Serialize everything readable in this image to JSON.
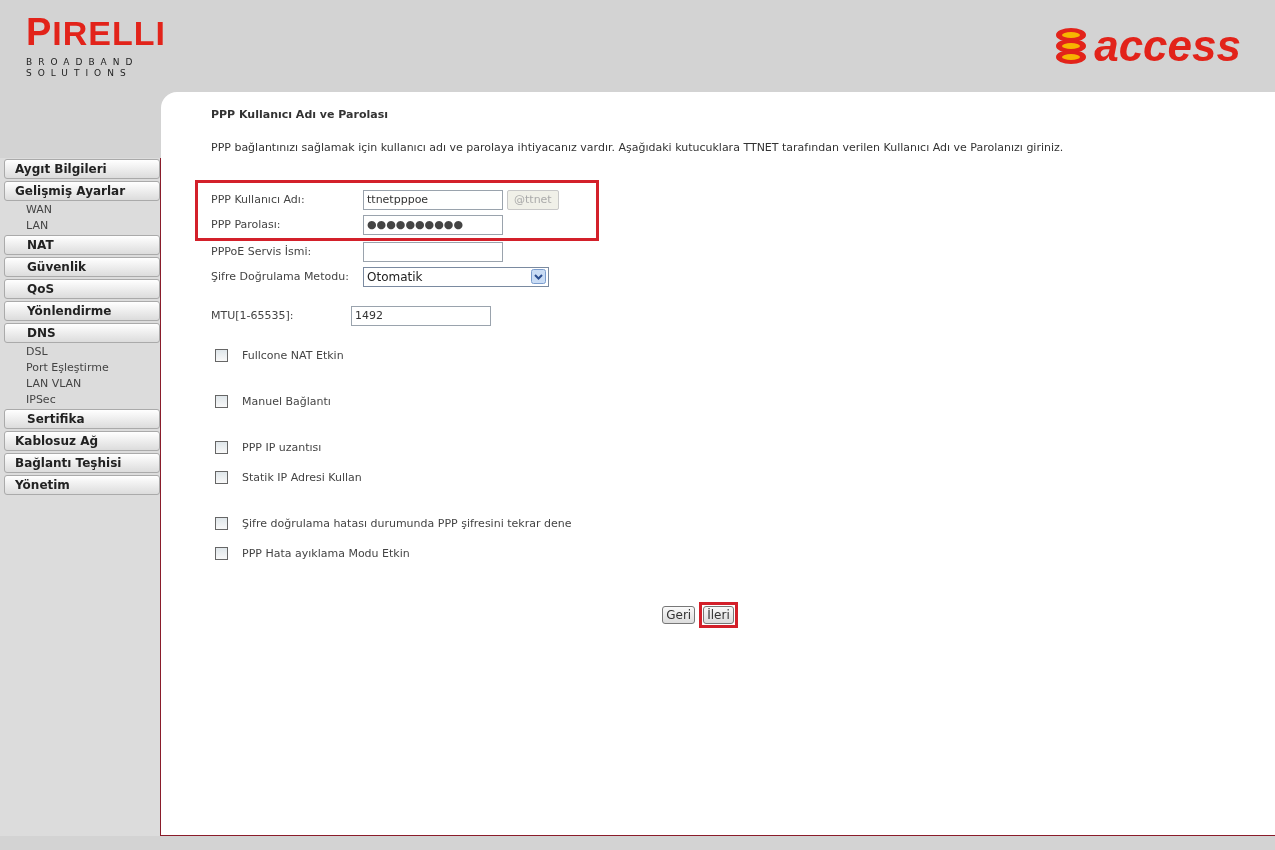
{
  "header": {
    "brand": "IRELLI",
    "brand_initial": "P",
    "brand_tagline": [
      "BROADBAND",
      "SOLUTIONS"
    ],
    "partner": "access"
  },
  "sidebar": {
    "items": [
      {
        "label": "Aygıt Bilgileri",
        "kind": "main"
      },
      {
        "label": "Gelişmiş Ayarlar",
        "kind": "main"
      },
      {
        "label": "WAN",
        "kind": "link"
      },
      {
        "label": "LAN",
        "kind": "link"
      },
      {
        "label": "NAT",
        "kind": "sub"
      },
      {
        "label": "Güvenlik",
        "kind": "sub"
      },
      {
        "label": "QoS",
        "kind": "sub"
      },
      {
        "label": "Yönlendirme",
        "kind": "sub"
      },
      {
        "label": "DNS",
        "kind": "sub"
      },
      {
        "label": "DSL",
        "kind": "link"
      },
      {
        "label": "Port Eşleştirme",
        "kind": "link"
      },
      {
        "label": "LAN VLAN",
        "kind": "link"
      },
      {
        "label": "IPSec",
        "kind": "link"
      },
      {
        "label": "Sertifika",
        "kind": "sub"
      },
      {
        "label": "Kablosuz Ağ",
        "kind": "main"
      },
      {
        "label": "Bağlantı Teşhisi",
        "kind": "main"
      },
      {
        "label": "Yönetim",
        "kind": "main"
      }
    ]
  },
  "page": {
    "title": "PPP Kullanıcı Adı ve Parolası",
    "description": "PPP bağlantınızı sağlamak için kullanıcı adı ve parolaya ihtiyacanız vardır. Aşağıdaki kutucuklara TTNET tarafından verilen Kullanıcı Adı ve Parolanızı giriniz.",
    "highlighted_fields": [
      {
        "label": "PPP Kullanıcı Adı:",
        "kind": "text",
        "value": "ttnetpppoe",
        "suffix_button": {
          "label": "@ttnet",
          "disabled": true
        }
      },
      {
        "label": "PPP Parolası:",
        "kind": "password",
        "value": "●●●●●●●●●●"
      }
    ],
    "fields": [
      {
        "label": "PPPoE Servis İsmi:",
        "kind": "text"
      },
      {
        "label": "Şifre Doğrulama Metodu:",
        "kind": "select",
        "value": "Otomatik"
      }
    ],
    "mtu": {
      "label": "MTU[1-65535]:",
      "value": "1492"
    },
    "checkbox_groups": [
      [
        {
          "label": "Fullcone NAT Etkin",
          "checked": false
        }
      ],
      [
        {
          "label": "Manuel Bağlantı",
          "checked": false
        }
      ],
      [
        {
          "label": "PPP IP uzantısı",
          "checked": false
        },
        {
          "label": "Statik IP Adresi Kullan",
          "checked": false
        }
      ],
      [
        {
          "label": "Şifre doğrulama hatası durumunda PPP şifresini tekrar dene",
          "checked": false
        },
        {
          "label": "PPP Hata ayıklama Modu Etkin",
          "checked": false
        }
      ]
    ],
    "buttons": [
      {
        "label": "Geri",
        "highlighted": false
      },
      {
        "label": "İleri",
        "highlighted": true
      }
    ]
  }
}
